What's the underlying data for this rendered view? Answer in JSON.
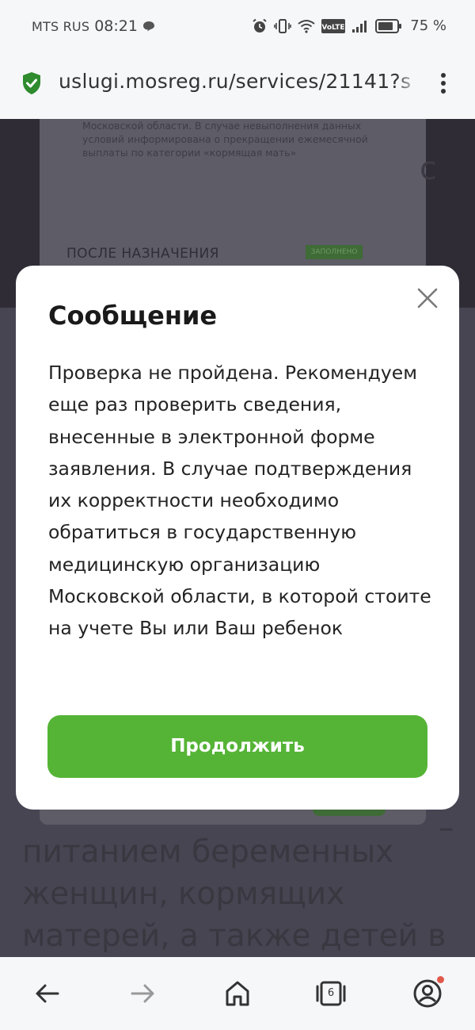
{
  "status_bar": {
    "carrier": "MTS RUS",
    "time": "08:21",
    "volte": "VoLTE",
    "battery": "75 %"
  },
  "browser": {
    "url": "uslugi.mosreg.ru/services/21141?s",
    "tabs_count": "6"
  },
  "background_page": {
    "card_text": "Московской области. В случае невыполнения данных условий информирована о прекращении ежемесячной выплаты по категории «кормящая мать»",
    "section_heading": "ПОСЛЕ НАЗНАЧЕНИЯ",
    "section_badge": "ЗАПОЛНЕНО",
    "side_letter": "с",
    "bottom_text": "питанием беременных женщин, кормящих матерей, а также детей в",
    "bottom_dash": "–"
  },
  "modal": {
    "title": "Сообщение",
    "body": "Проверка не пройдена. Рекомендуем еще раз проверить сведения, внесенные в электронной форме заявления. В случае подтверждения их корректности необходимо обратиться в государственную медицинскую организацию Московской области, в которой стоите на учете Вы или Ваш ребенок",
    "button_label": "Продолжить"
  },
  "colors": {
    "accent_green": "#55b436",
    "overlay": "#474552",
    "shield_green": "#2e8b2e",
    "notification_dot": "#e05a4b"
  },
  "icons": [
    "shield-icon",
    "kebab-menu-icon",
    "close-icon",
    "back-arrow-icon",
    "forward-arrow-icon",
    "home-icon",
    "tabs-icon",
    "profile-icon",
    "alarm-icon",
    "vibrate-icon",
    "wifi-icon",
    "signal-icon",
    "battery-icon",
    "chat-icon"
  ]
}
